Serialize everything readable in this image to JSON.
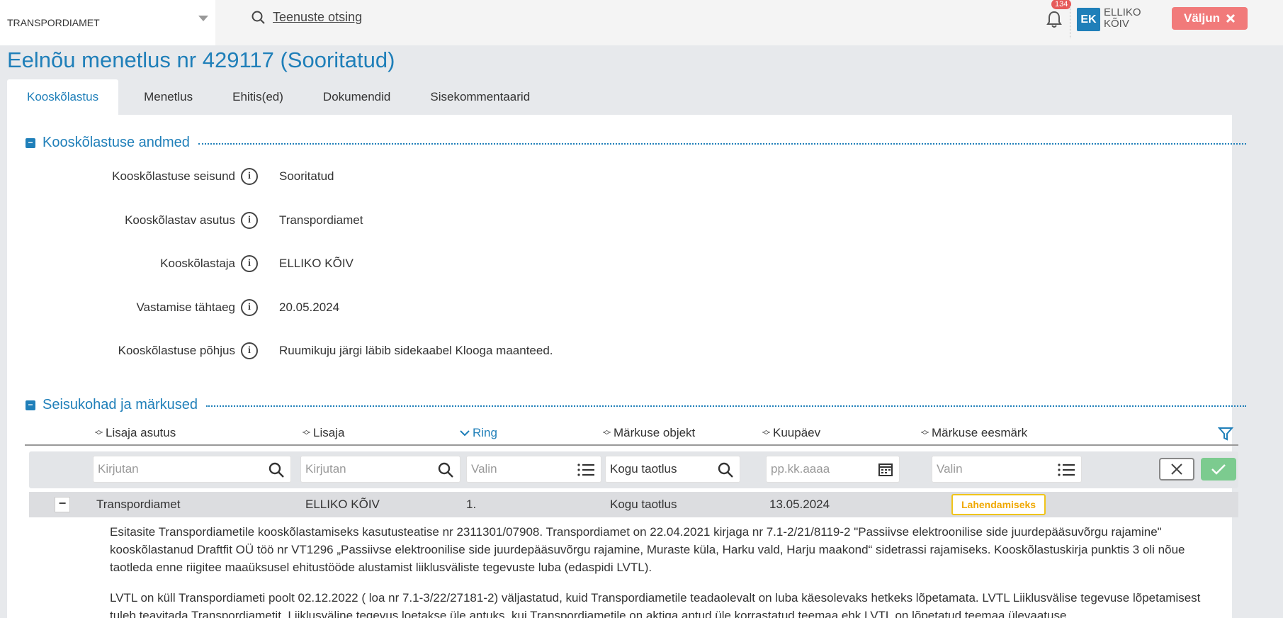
{
  "org_select": {
    "value": "TRANSPORDIAMET"
  },
  "search": {
    "label": "Teenuste otsing"
  },
  "notifications": {
    "count": "134"
  },
  "user": {
    "initials": "EK",
    "name_line1": "ELLIKO",
    "name_line2": "KÕIV"
  },
  "logout": {
    "label": "Väljun"
  },
  "page_title": "Eelnõu menetlus nr 429117 (Sooritatud)",
  "tabs": [
    {
      "label": "Kooskõlastus"
    },
    {
      "label": "Menetlus"
    },
    {
      "label": "Ehitis(ed)"
    },
    {
      "label": "Dokumendid"
    },
    {
      "label": "Sisekommentaarid"
    }
  ],
  "section1": {
    "title": "Kooskõlastuse andmed",
    "fields": [
      {
        "label": "Kooskõlastuse seisund",
        "value": "Sooritatud"
      },
      {
        "label": "Kooskõlastav asutus",
        "value": "Transpordiamet"
      },
      {
        "label": "Kooskõlastaja",
        "value": "ELLIKO KÕIV"
      },
      {
        "label": "Vastamise tähtaeg",
        "value": "20.05.2024"
      },
      {
        "label": "Kooskõlastuse põhjus",
        "value": "Ruumikuju järgi läbib sidekaabel Klooga maanteed."
      }
    ]
  },
  "section2": {
    "title": "Seisukohad ja märkused",
    "columns": [
      {
        "label": "Lisaja asutus"
      },
      {
        "label": "Lisaja"
      },
      {
        "label": "Ring"
      },
      {
        "label": "Märkuse objekt"
      },
      {
        "label": "Kuupäev"
      },
      {
        "label": "Märkuse eesmärk"
      }
    ],
    "filters": {
      "lisaja_asutus": "Kirjutan",
      "lisaja": "Kirjutan",
      "ring": "Valin",
      "objekt": "Kogu taotlus",
      "kuupaev": "pp.kk.aaaa",
      "eesmark": "Valin"
    },
    "row": {
      "asutus": "Transpordiamet",
      "lisaja": "ELLIKO KÕIV",
      "ring": "1.",
      "objekt": "Kogu taotlus",
      "kuupaev": "13.05.2024",
      "eesmark": "Lahendamiseks"
    },
    "comment_p1": "Esitasite Transpordiametile kooskõlastamiseks kasutusteatise nr 2311301/07908. Transpordiamet on 22.04.2021 kirjaga nr 7.1-2/21/8119-2 \"Passiivse elektroonilise side juurdepääsuvõrgu rajamine\" kooskõlastanud Draftfit OÜ töö nr VT1296 „Passiivse elektroonilise side juurdepääsuvõrgu rajamine, Muraste küla, Harku vald, Harju maakond“ sidetrassi rajamiseks. Kooskõlastuskirja punktis 3 oli nõue taotleda enne riigitee maaüksusel ehitustööde alustamist liiklusväliste tegevuste luba (edaspidi LVTL).",
    "comment_p2": "LVTL on küll Transpordiameti poolt 02.12.2022 ( loa nr 7.1-3/22/27181-2) väljastatud, kuid Transpordiametile teadaolevalt on luba käesolevaks hetkeks lõpetamata. LVTL Liiklusvälise tegevuse lõpetamisest tuleb teavitada Transpordiametit. Liiklusväline tegevus loetakse üle antuks, kui Transpordiametile on aktiga antud üle korrastatud teemaa ehk LVTL on lõpetatud teemaa ülevaatuse"
  },
  "colors": {
    "accent": "#1f7fb9",
    "logout": "#f17a7a",
    "badge": "#f0c419",
    "apply": "#7ccb8f"
  }
}
